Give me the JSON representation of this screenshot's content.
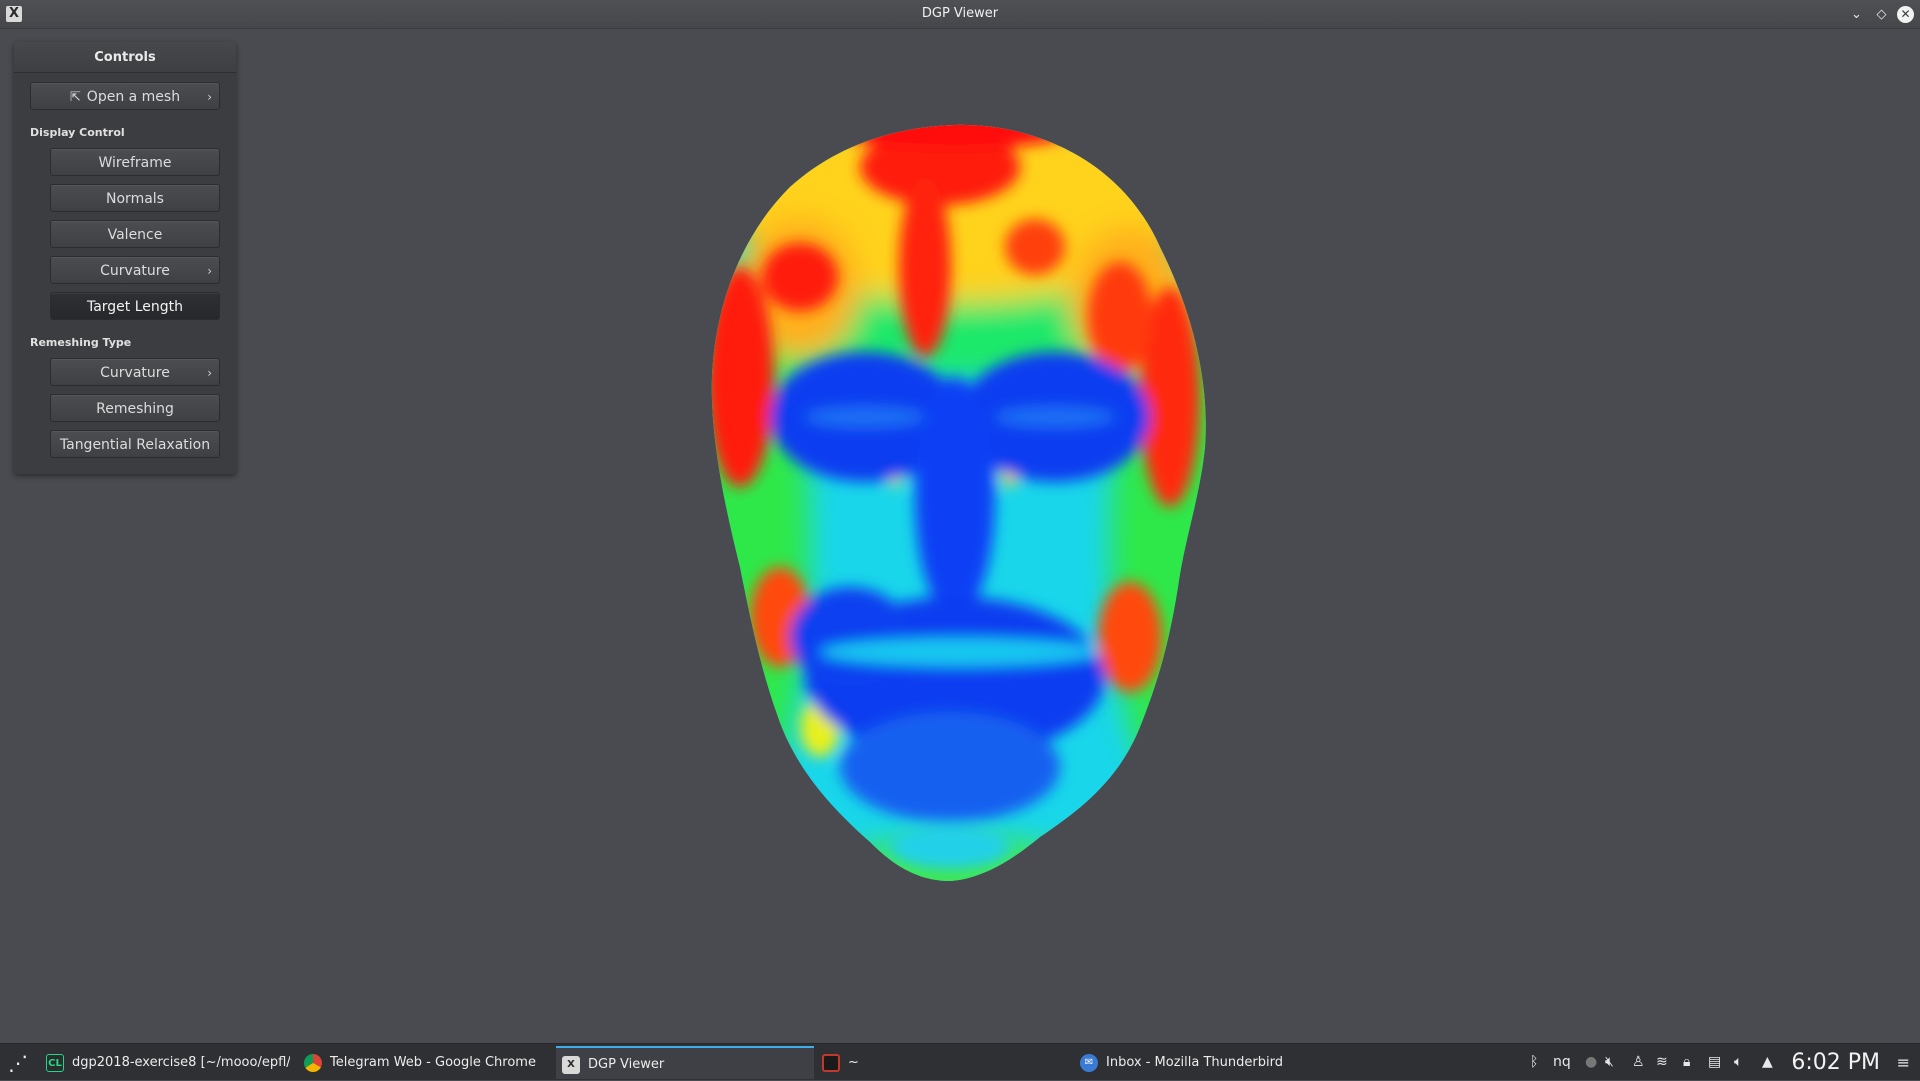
{
  "window": {
    "title": "DGP Viewer",
    "app_icon": "x-app-icon",
    "buttons": [
      "minimize",
      "restore",
      "close"
    ]
  },
  "panel": {
    "header": "Controls",
    "open_mesh": "Open a mesh",
    "display_control_label": "Display Control",
    "display_buttons": [
      "Wireframe",
      "Normals",
      "Valence",
      "Curvature",
      "Target Length"
    ],
    "remeshing_type_label": "Remeshing Type",
    "remeshing_buttons": [
      "Curvature",
      "Remeshing",
      "Tangential Relaxation"
    ]
  },
  "viewport": {
    "content": "curvature-colored face mesh",
    "colormap": [
      "#0000ff",
      "#00ffff",
      "#00ff00",
      "#ffff00",
      "#ff0000"
    ],
    "background": "#4a4b50"
  },
  "taskbar": {
    "tasks": [
      {
        "label": "dgp2018-exercise8 [~/mooo/epfl/...",
        "icon": "clion-icon",
        "active": false
      },
      {
        "label": "Telegram Web - Google Chrome",
        "icon": "chrome-icon",
        "active": false
      },
      {
        "label": "DGP Viewer",
        "icon": "x-app-icon",
        "active": true
      },
      {
        "label": "~",
        "icon": "terminal-icon",
        "active": false
      },
      {
        "label": "Inbox - Mozilla Thunderbird",
        "icon": "thunderbird-icon",
        "active": false
      }
    ],
    "tray_text": "nq",
    "clock": "6:02 PM"
  },
  "colors": {
    "accent": "#3daee9",
    "panel_bg": "#3c3d40",
    "titlebar": "#4b4c50"
  }
}
